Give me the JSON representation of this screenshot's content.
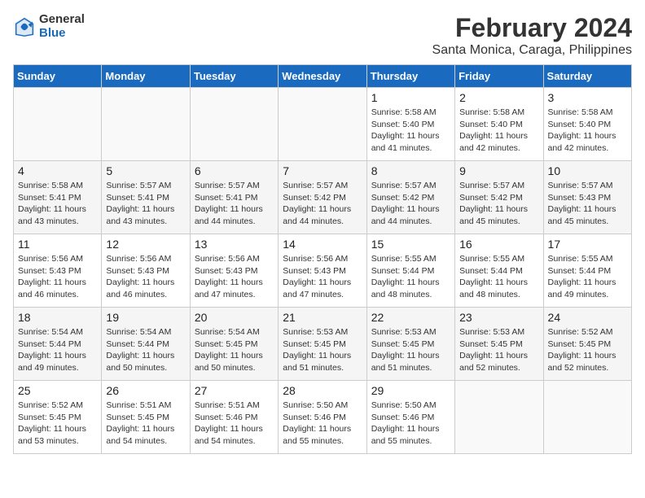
{
  "logo": {
    "general": "General",
    "blue": "Blue"
  },
  "title": "February 2024",
  "subtitle": "Santa Monica, Caraga, Philippines",
  "days_of_week": [
    "Sunday",
    "Monday",
    "Tuesday",
    "Wednesday",
    "Thursday",
    "Friday",
    "Saturday"
  ],
  "weeks": [
    [
      {
        "day": "",
        "detail": ""
      },
      {
        "day": "",
        "detail": ""
      },
      {
        "day": "",
        "detail": ""
      },
      {
        "day": "",
        "detail": ""
      },
      {
        "day": "1",
        "detail": "Sunrise: 5:58 AM\nSunset: 5:40 PM\nDaylight: 11 hours\nand 41 minutes."
      },
      {
        "day": "2",
        "detail": "Sunrise: 5:58 AM\nSunset: 5:40 PM\nDaylight: 11 hours\nand 42 minutes."
      },
      {
        "day": "3",
        "detail": "Sunrise: 5:58 AM\nSunset: 5:40 PM\nDaylight: 11 hours\nand 42 minutes."
      }
    ],
    [
      {
        "day": "4",
        "detail": "Sunrise: 5:58 AM\nSunset: 5:41 PM\nDaylight: 11 hours\nand 43 minutes."
      },
      {
        "day": "5",
        "detail": "Sunrise: 5:57 AM\nSunset: 5:41 PM\nDaylight: 11 hours\nand 43 minutes."
      },
      {
        "day": "6",
        "detail": "Sunrise: 5:57 AM\nSunset: 5:41 PM\nDaylight: 11 hours\nand 44 minutes."
      },
      {
        "day": "7",
        "detail": "Sunrise: 5:57 AM\nSunset: 5:42 PM\nDaylight: 11 hours\nand 44 minutes."
      },
      {
        "day": "8",
        "detail": "Sunrise: 5:57 AM\nSunset: 5:42 PM\nDaylight: 11 hours\nand 44 minutes."
      },
      {
        "day": "9",
        "detail": "Sunrise: 5:57 AM\nSunset: 5:42 PM\nDaylight: 11 hours\nand 45 minutes."
      },
      {
        "day": "10",
        "detail": "Sunrise: 5:57 AM\nSunset: 5:43 PM\nDaylight: 11 hours\nand 45 minutes."
      }
    ],
    [
      {
        "day": "11",
        "detail": "Sunrise: 5:56 AM\nSunset: 5:43 PM\nDaylight: 11 hours\nand 46 minutes."
      },
      {
        "day": "12",
        "detail": "Sunrise: 5:56 AM\nSunset: 5:43 PM\nDaylight: 11 hours\nand 46 minutes."
      },
      {
        "day": "13",
        "detail": "Sunrise: 5:56 AM\nSunset: 5:43 PM\nDaylight: 11 hours\nand 47 minutes."
      },
      {
        "day": "14",
        "detail": "Sunrise: 5:56 AM\nSunset: 5:43 PM\nDaylight: 11 hours\nand 47 minutes."
      },
      {
        "day": "15",
        "detail": "Sunrise: 5:55 AM\nSunset: 5:44 PM\nDaylight: 11 hours\nand 48 minutes."
      },
      {
        "day": "16",
        "detail": "Sunrise: 5:55 AM\nSunset: 5:44 PM\nDaylight: 11 hours\nand 48 minutes."
      },
      {
        "day": "17",
        "detail": "Sunrise: 5:55 AM\nSunset: 5:44 PM\nDaylight: 11 hours\nand 49 minutes."
      }
    ],
    [
      {
        "day": "18",
        "detail": "Sunrise: 5:54 AM\nSunset: 5:44 PM\nDaylight: 11 hours\nand 49 minutes."
      },
      {
        "day": "19",
        "detail": "Sunrise: 5:54 AM\nSunset: 5:44 PM\nDaylight: 11 hours\nand 50 minutes."
      },
      {
        "day": "20",
        "detail": "Sunrise: 5:54 AM\nSunset: 5:45 PM\nDaylight: 11 hours\nand 50 minutes."
      },
      {
        "day": "21",
        "detail": "Sunrise: 5:53 AM\nSunset: 5:45 PM\nDaylight: 11 hours\nand 51 minutes."
      },
      {
        "day": "22",
        "detail": "Sunrise: 5:53 AM\nSunset: 5:45 PM\nDaylight: 11 hours\nand 51 minutes."
      },
      {
        "day": "23",
        "detail": "Sunrise: 5:53 AM\nSunset: 5:45 PM\nDaylight: 11 hours\nand 52 minutes."
      },
      {
        "day": "24",
        "detail": "Sunrise: 5:52 AM\nSunset: 5:45 PM\nDaylight: 11 hours\nand 52 minutes."
      }
    ],
    [
      {
        "day": "25",
        "detail": "Sunrise: 5:52 AM\nSunset: 5:45 PM\nDaylight: 11 hours\nand 53 minutes."
      },
      {
        "day": "26",
        "detail": "Sunrise: 5:51 AM\nSunset: 5:45 PM\nDaylight: 11 hours\nand 54 minutes."
      },
      {
        "day": "27",
        "detail": "Sunrise: 5:51 AM\nSunset: 5:46 PM\nDaylight: 11 hours\nand 54 minutes."
      },
      {
        "day": "28",
        "detail": "Sunrise: 5:50 AM\nSunset: 5:46 PM\nDaylight: 11 hours\nand 55 minutes."
      },
      {
        "day": "29",
        "detail": "Sunrise: 5:50 AM\nSunset: 5:46 PM\nDaylight: 11 hours\nand 55 minutes."
      },
      {
        "day": "",
        "detail": ""
      },
      {
        "day": "",
        "detail": ""
      }
    ]
  ]
}
